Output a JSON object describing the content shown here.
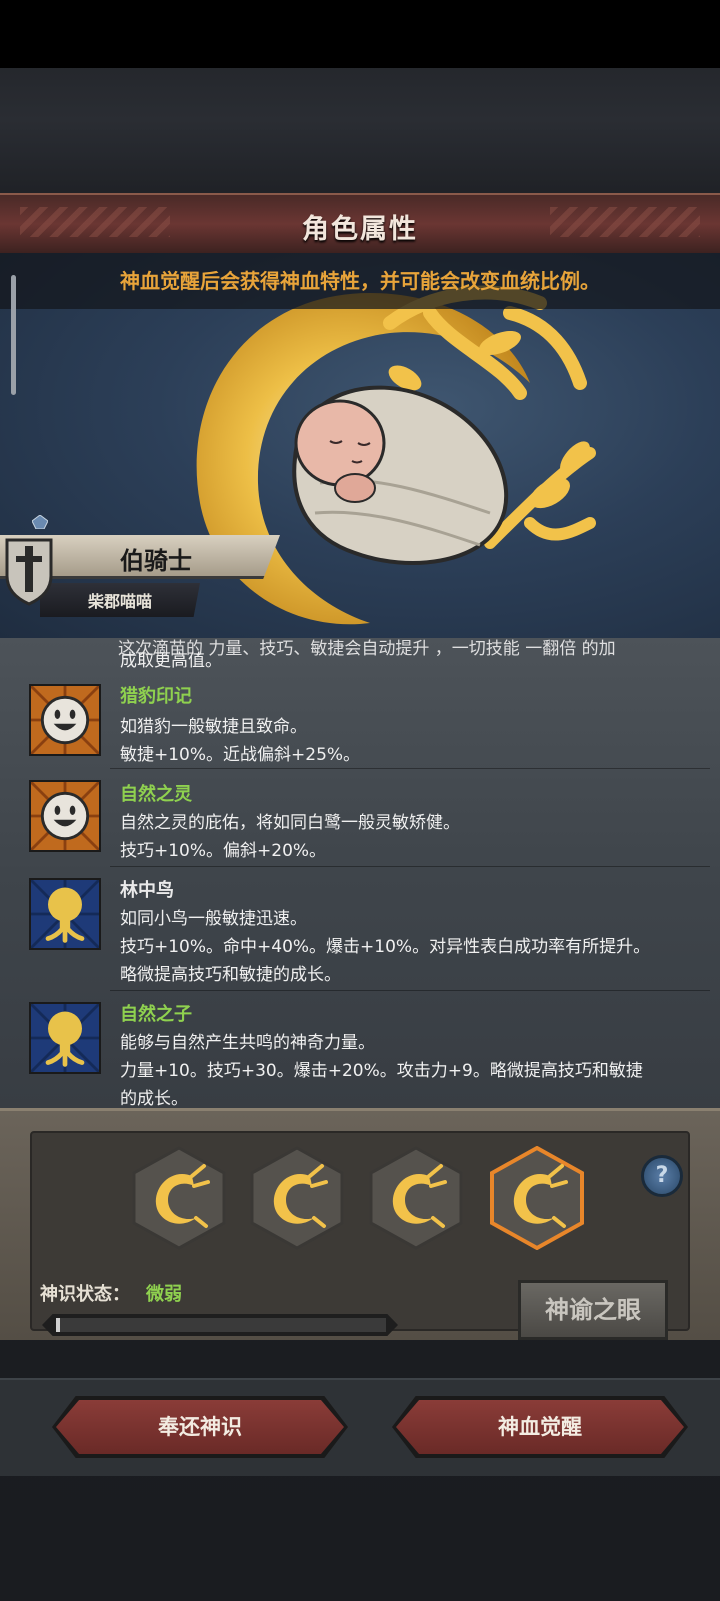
{
  "header": {
    "title": "角色属性"
  },
  "hero": {
    "notice": "神血觉醒后会获得神血特性，并可能会改变血统比例。",
    "rank_title": "伯骑士",
    "owner_name": "柴郡喵喵"
  },
  "traits": {
    "cut_line": "这次滴苗的 力量、技巧、敏捷会自动提升 ，一切技能 一翻倍 的加",
    "cut_line2": "成取更高值。",
    "items": [
      {
        "name": "猎豹印记",
        "name_color": "#8fd14f",
        "icon": "smile-face-icon",
        "lines": [
          "如猎豹一般敏捷且致命。",
          "敏捷+10%。近战偏斜+25%。"
        ]
      },
      {
        "name": "自然之灵",
        "name_color": "#8fd14f",
        "icon": "smile-face-icon",
        "lines": [
          "自然之灵的庇佑，将如同白鹭一般灵敏矫健。",
          "技巧+10%。偏斜+20%。"
        ]
      },
      {
        "name": "林中鸟",
        "name_color": "#eaeaea",
        "icon": "golden-tree-icon",
        "lines": [
          "如同小鸟一般敏捷迅速。",
          "技巧+10%。命中+40%。爆击+10%。对异性表白成功率有所提升。",
          "略微提高技巧和敏捷的成长。"
        ]
      },
      {
        "name": "自然之子",
        "name_color": "#8fd14f",
        "icon": "golden-tree-icon",
        "lines": [
          "能够与自然产生共鸣的神奇力量。",
          "力量+10。技巧+30。爆击+20%。攻击力+9。略微提高技巧和敏捷",
          "的成长。"
        ]
      }
    ]
  },
  "panel": {
    "status_label": "神识状态：",
    "status_value": "微弱",
    "progress": 0.01,
    "oracle_button": "神谕之眼",
    "help_label": "?",
    "seal_count": 4,
    "active_seal": 4
  },
  "actions": {
    "return_label": "奉还神识",
    "awaken_label": "神血觉醒"
  },
  "colors": {
    "accent_orange": "#e8a43a",
    "green": "#8fd14f",
    "button_red": "#8a3c38"
  }
}
